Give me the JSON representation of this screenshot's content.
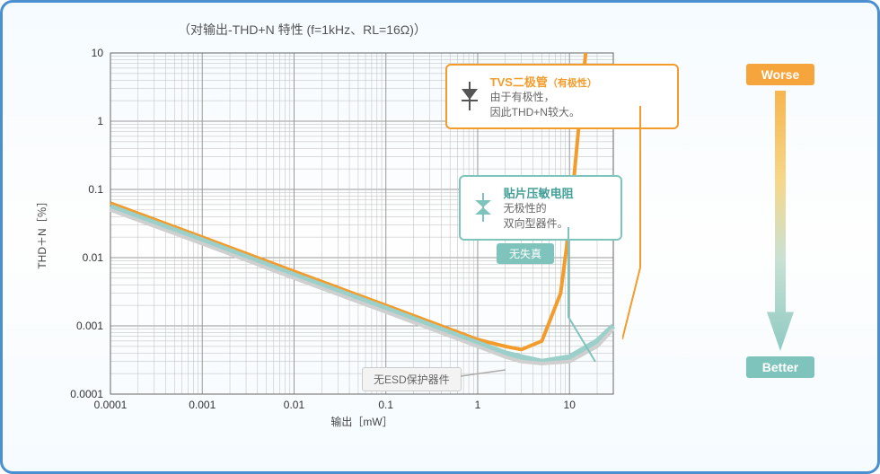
{
  "title": "（对输出-THD+N 特性 (f=1kHz、RL=16Ω)）",
  "ylabel": "THD＋N［％］",
  "xlabel": "输出［mW］",
  "x_ticks": [
    "0.0001",
    "0.001",
    "0.01",
    "0.1",
    "1",
    "10"
  ],
  "y_ticks": [
    "0.0001",
    "0.001",
    "0.01",
    "0.1",
    "1",
    "10"
  ],
  "callouts": {
    "orange": {
      "title": "TVS二极管",
      "subtitle": "（有极性）",
      "line1": "由于有极性，",
      "line2": "因此THD+N较大。"
    },
    "teal": {
      "title": "贴片压敏电阻",
      "line1": "无极性的",
      "line2": "双向型器件。"
    }
  },
  "badge": "无失真",
  "grey_label": "无ESD保护器件",
  "wb": {
    "worse": "Worse",
    "better": "Better"
  },
  "chart_data": {
    "type": "line",
    "title": "对输出-THD+N 特性 (f=1kHz, RL=16Ω)",
    "xlabel": "输出[mW]",
    "ylabel": "THD+N[%]",
    "x_scale": "log",
    "y_scale": "log",
    "xlim": [
      0.0001,
      30
    ],
    "ylim": [
      0.0001,
      10
    ],
    "series": [
      {
        "name": "TVS二极管 (有极性)",
        "color": "#f39c2c",
        "x": [
          0.0001,
          0.001,
          0.01,
          0.1,
          1,
          2,
          3,
          5,
          8,
          10,
          15
        ],
        "y": [
          0.063,
          0.02,
          0.0063,
          0.002,
          0.00063,
          0.0005,
          0.00045,
          0.0006,
          0.003,
          0.03,
          10
        ]
      },
      {
        "name": "贴片压敏电阻",
        "color": "#9bcfc9",
        "x": [
          0.0001,
          0.001,
          0.01,
          0.1,
          1,
          2,
          3,
          5,
          10,
          20,
          30
        ],
        "y": [
          0.056,
          0.018,
          0.0056,
          0.0018,
          0.00056,
          0.0004,
          0.00035,
          0.0003,
          0.00035,
          0.0006,
          0.001
        ]
      },
      {
        "name": "无ESD保护器件",
        "color": "#cfcfcf",
        "x": [
          0.0001,
          0.001,
          0.01,
          0.1,
          1,
          2,
          3,
          5,
          10,
          20,
          30
        ],
        "y": [
          0.05,
          0.016,
          0.005,
          0.0016,
          0.0005,
          0.00035,
          0.0003,
          0.00028,
          0.0003,
          0.0005,
          0.0009
        ]
      }
    ]
  }
}
